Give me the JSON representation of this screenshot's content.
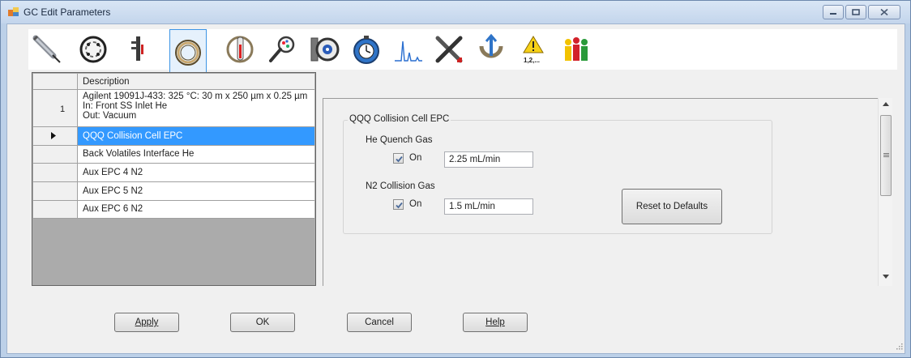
{
  "window": {
    "title": "GC Edit Parameters",
    "icons": {
      "app": "gc-app-icon",
      "minimize": "minimize-icon",
      "maximize": "maximize-icon",
      "close": "close-icon"
    }
  },
  "toolbar": {
    "tools": [
      {
        "name": "injector-syringe-icon"
      },
      {
        "name": "valve-icon"
      },
      {
        "name": "inlet-icon"
      },
      {
        "name": "column-icon",
        "selected": true
      },
      {
        "name": "oven-icon"
      },
      {
        "name": "detector-icon"
      },
      {
        "name": "signal-gauge-icon"
      },
      {
        "name": "runtime-clock-icon"
      },
      {
        "name": "chromatogram-icon"
      },
      {
        "name": "configuration-tools-icon"
      },
      {
        "name": "pressure-pump-icon"
      },
      {
        "name": "warning-icon",
        "label": "1,2,..."
      },
      {
        "name": "people-status-icon"
      }
    ]
  },
  "grid": {
    "header": {
      "description": "Description"
    },
    "rows": [
      {
        "num": "1",
        "description": "Agilent 19091J-433: 325 °C: 30 m x 250 µm x 0.25 µm\nIn: Front SS Inlet He\nOut: Vacuum"
      },
      {
        "num": "",
        "description": "QQQ Collision Cell EPC",
        "selected": true
      },
      {
        "num": "",
        "description": "Back Volatiles Interface He"
      },
      {
        "num": "",
        "description": "Aux EPC 4 N2"
      },
      {
        "num": "",
        "description": "Aux EPC 5 N2"
      },
      {
        "num": "",
        "description": "Aux EPC 6 N2"
      }
    ]
  },
  "panel": {
    "group_title": "QQQ Collision Cell EPC",
    "he_quench": {
      "label": "He Quench Gas",
      "on_label": "On",
      "checked": true,
      "value": "2.25 mL/min"
    },
    "n2_collision": {
      "label": "N2 Collision Gas",
      "on_label": "On",
      "checked": true,
      "value": "1.5 mL/min"
    },
    "reset_label": "Reset to Defaults"
  },
  "buttons": {
    "apply": "Apply",
    "ok": "OK",
    "cancel": "Cancel",
    "help": "Help"
  },
  "colors": {
    "selection": "#3399ff",
    "accent": "#3d95e5"
  }
}
